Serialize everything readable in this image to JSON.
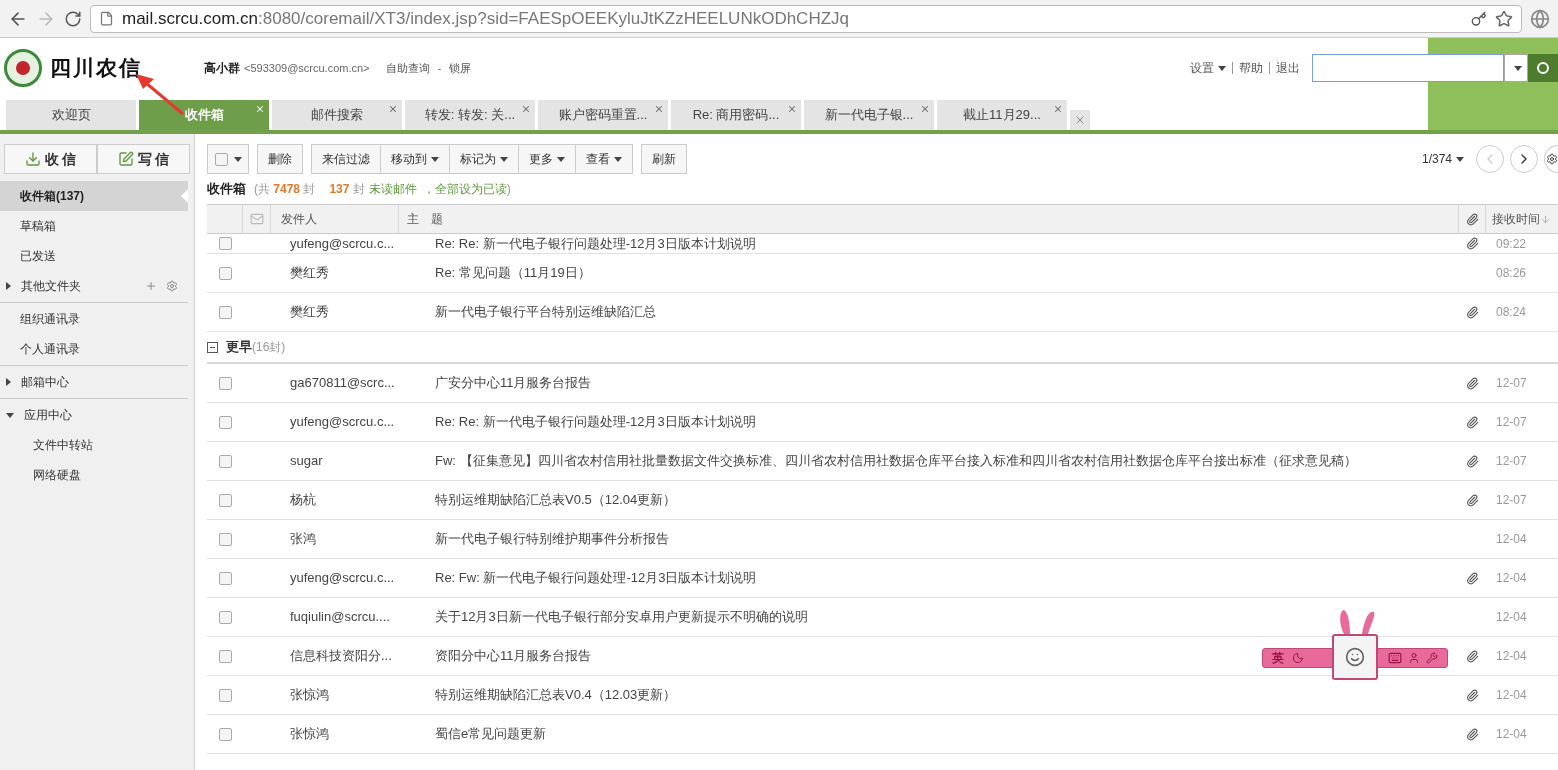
{
  "browser": {
    "back_disabled": false,
    "forward_disabled": true,
    "url_host": "mail.scrcu.com.cn",
    "url_rest": ":8080/coremail/XT3/index.jsp?sid=FAESpOEEKyluJtKZzHEELUNkODhCHZJq"
  },
  "header": {
    "logo_text": "四川农信",
    "user_name": "高小群",
    "user_email": "<593309@scrcu.com.cn>",
    "links": [
      "自助查询",
      "锁屏"
    ],
    "separator": "-",
    "right_links": [
      {
        "label": "设置",
        "menu": true
      },
      {
        "label": "帮助",
        "menu": false
      },
      {
        "label": "退出",
        "menu": false
      }
    ]
  },
  "tabs": [
    {
      "label": "欢迎页",
      "selected": false,
      "closable": false
    },
    {
      "label": "收件箱",
      "selected": true,
      "closable": true
    },
    {
      "label": "邮件搜索",
      "selected": false,
      "closable": true
    },
    {
      "label": "转发: 转发: 关...",
      "selected": false,
      "closable": true
    },
    {
      "label": "账户密码重置...",
      "selected": false,
      "closable": true
    },
    {
      "label": "Re: 商用密码...",
      "selected": false,
      "closable": true
    },
    {
      "label": "新一代电子银...",
      "selected": false,
      "closable": true
    },
    {
      "label": "截止11月29...",
      "selected": false,
      "closable": true
    }
  ],
  "sidebar": {
    "actions": [
      {
        "kind": "receive",
        "label": "收 信"
      },
      {
        "kind": "compose",
        "label": "写 信"
      }
    ],
    "groups": [
      [
        {
          "label": "收件箱(137)",
          "selected": true
        },
        {
          "label": "草稿箱",
          "selected": false
        },
        {
          "label": "已发送",
          "selected": false
        },
        {
          "label": "其他文件夹",
          "selected": false,
          "expanded": false,
          "tools": true
        }
      ],
      [
        {
          "label": "组织通讯录",
          "selected": false
        },
        {
          "label": "个人通讯录",
          "selected": false
        }
      ],
      [
        {
          "label": "邮箱中心",
          "selected": false,
          "expanded": false
        }
      ],
      [
        {
          "label": "应用中心",
          "selected": false,
          "expanded": true,
          "children": [
            {
              "label": "文件中转站",
              "selected": false
            },
            {
              "label": "网络硬盘",
              "selected": false
            }
          ]
        }
      ]
    ]
  },
  "toolbar": {
    "select_all": {
      "checked": false
    },
    "button_groups": [
      [
        {
          "label": "删除",
          "menu": false
        }
      ],
      [
        {
          "label": "来信过滤",
          "menu": false
        },
        {
          "label": "移动到",
          "menu": true
        },
        {
          "label": "标记为",
          "menu": true
        },
        {
          "label": "更多",
          "menu": true
        },
        {
          "label": "查看",
          "menu": true
        }
      ],
      [
        {
          "label": "刷新",
          "menu": false
        }
      ]
    ],
    "page": "1/374",
    "prev_disabled": true,
    "next_disabled": false
  },
  "summary": {
    "folder": "收件箱",
    "open": "(共",
    "total": "7478",
    "total_unit": "封",
    "unread": "137",
    "unread_unit": "封",
    "unread_link": "未读邮件",
    "mark_all_link": "，全部设为已读",
    "close": ")"
  },
  "table": {
    "columns": {
      "sender": "发件人",
      "subject": "主　题",
      "time": "接收时间"
    },
    "sections": [
      {
        "rows": [
          {
            "sender": "yufeng@scrcu.c...",
            "subject": "Re: Re: 新一代电子银行问题处理-12月3日版本计划说明",
            "attachment": true,
            "time": "09:22",
            "checked": false
          },
          {
            "sender": "樊红秀",
            "subject": "Re: 常见问题（11月19日）",
            "attachment": false,
            "time": "08:26",
            "checked": false
          },
          {
            "sender": "樊红秀",
            "subject": "新一代电子银行平台特别运维缺陷汇总",
            "attachment": true,
            "time": "08:24",
            "checked": false
          }
        ]
      },
      {
        "header": {
          "title": "更早",
          "count": "(16封)",
          "expanded": true
        },
        "rows": [
          {
            "sender": "ga670811@scrc...",
            "subject": "广安分中心11月服务台报告",
            "attachment": true,
            "time": "12-07",
            "checked": false
          },
          {
            "sender": "yufeng@scrcu.c...",
            "subject": "Re: Re: 新一代电子银行问题处理-12月3日版本计划说明",
            "attachment": true,
            "time": "12-07",
            "checked": false
          },
          {
            "sender": "sugar",
            "subject": "Fw: 【征集意见】四川省农村信用社批量数据文件交换标准、四川省农村信用社数据仓库平台接入标准和四川省农村信用社数据仓库平台接出标准（征求意见稿）",
            "attachment": true,
            "time": "12-07",
            "checked": false
          },
          {
            "sender": "杨杭",
            "subject": "特别运维期缺陷汇总表V0.5（12.04更新）",
            "attachment": true,
            "time": "12-07",
            "checked": false
          },
          {
            "sender": "张鸿",
            "subject": "新一代电子银行特别维护期事件分析报告",
            "attachment": false,
            "time": "12-04",
            "checked": false
          },
          {
            "sender": "yufeng@scrcu.c...",
            "subject": "Re: Fw: 新一代电子银行问题处理-12月3日版本计划说明",
            "attachment": true,
            "time": "12-04",
            "checked": false
          },
          {
            "sender": "fuqiulin@scrcu....",
            "subject": "关于12月3日新一代电子银行部分安卓用户更新提示不明确的说明",
            "attachment": false,
            "time": "12-04",
            "checked": false
          },
          {
            "sender": "信息科技资阳分...",
            "subject": "资阳分中心11月服务台报告",
            "attachment": true,
            "time": "12-04",
            "checked": false
          },
          {
            "sender": "张惊鸿",
            "subject": "特别运维期缺陷汇总表V0.4（12.03更新）",
            "attachment": true,
            "time": "12-04",
            "checked": false
          },
          {
            "sender": "张惊鸿",
            "subject": "蜀信e常见问题更新",
            "attachment": true,
            "time": "12-04",
            "checked": false
          }
        ]
      }
    ]
  },
  "ime": {
    "mode": "英"
  }
}
